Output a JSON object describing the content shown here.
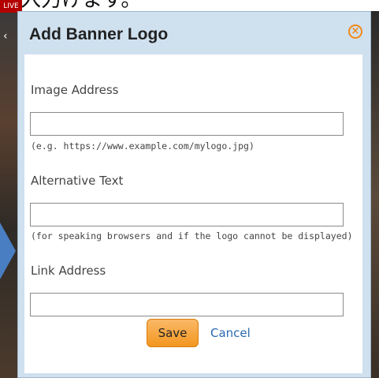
{
  "caption": {
    "text": "を入力けます。"
  },
  "background": {
    "badge": "LIVE"
  },
  "dialog": {
    "title": "Add Banner Logo",
    "close_icon": "close-icon",
    "fields": [
      {
        "label": "Image Address",
        "value": "",
        "hint": "(e.g. https://www.example.com/mylogo.jpg)"
      },
      {
        "label": "Alternative Text",
        "value": "",
        "hint": "(for speaking browsers and if the logo cannot be displayed)"
      },
      {
        "label": "Link Address",
        "value": "",
        "hint": ""
      }
    ],
    "save_label": "Save",
    "cancel_label": "Cancel"
  },
  "colors": {
    "accent_orange": "#f2961f",
    "dialog_frame": "#cfe0ef",
    "link_blue": "#2a6ab0",
    "arrow_blue": "#4a7ec2"
  }
}
